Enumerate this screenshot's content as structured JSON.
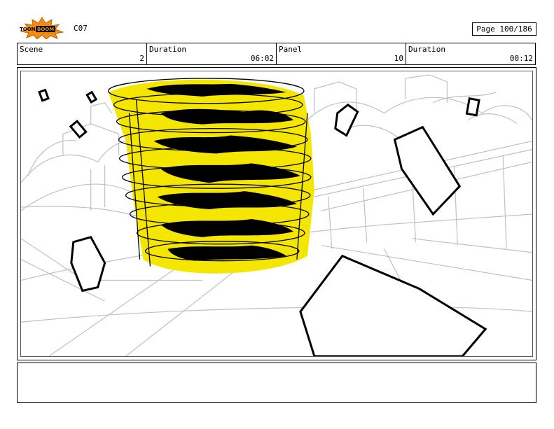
{
  "header": {
    "episode": "C07",
    "page": "Page 100/186"
  },
  "info": {
    "scene_label": "Scene",
    "scene_value": "2",
    "scene_duration_label": "Duration",
    "scene_duration_value": "06:02",
    "panel_label": "Panel",
    "panel_value": "10",
    "panel_duration_label": "Duration",
    "panel_duration_value": "00:12"
  },
  "colors": {
    "tornado": "#f5e600",
    "sketch": "#b8b8b8",
    "ink": "#000000",
    "logo_orange": "#f28c0f"
  },
  "icons": {
    "logo": "toonboom-logo-icon"
  }
}
